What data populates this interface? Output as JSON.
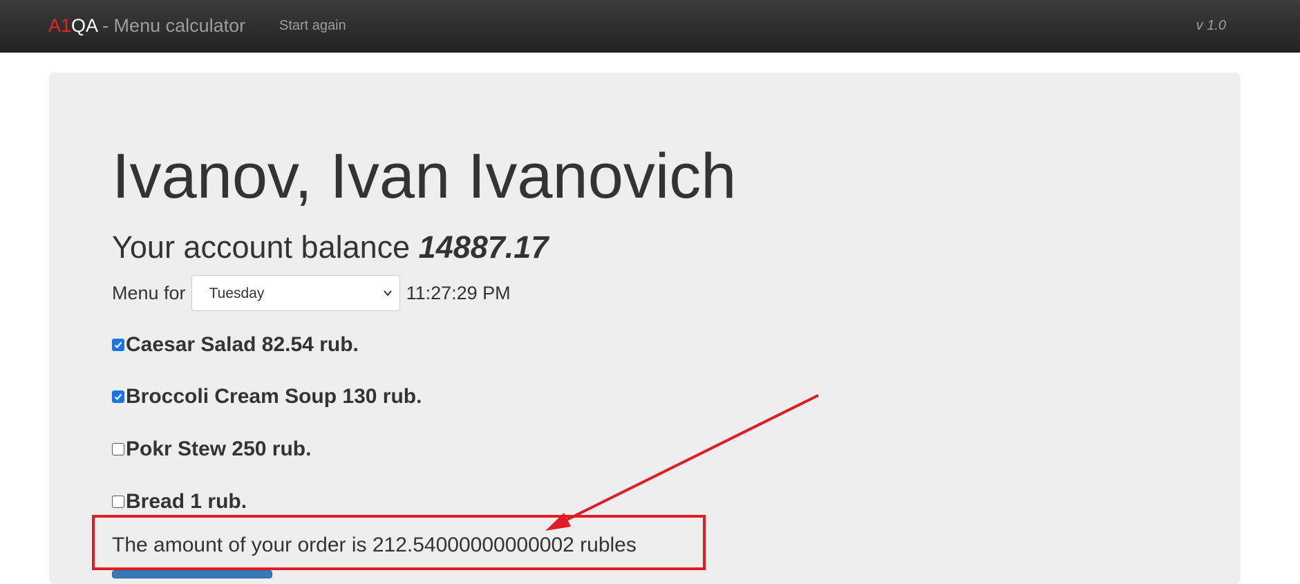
{
  "navbar": {
    "brand_a1": "A1",
    "brand_qa": "QA",
    "brand_rest": " - Menu calculator",
    "start_again": "Start again",
    "version": "v 1.0"
  },
  "user": {
    "name": "Ivanov, Ivan Ivanovich"
  },
  "account": {
    "balance_label": "Your account balance ",
    "balance_value": "14887.17"
  },
  "menu": {
    "label": "Menu for",
    "selected_day": "Tuesday",
    "time": "11:27:29 PM"
  },
  "dishes": [
    {
      "label": "Caesar Salad 82.54 rub.",
      "checked": true
    },
    {
      "label": "Broccoli Cream Soup 130 rub.",
      "checked": true
    },
    {
      "label": "Pokr Stew 250 rub.",
      "checked": false
    },
    {
      "label": "Bread 1 rub.",
      "checked": false
    }
  ],
  "order": {
    "total_text": "The amount of your order is 212.54000000000002 rubles"
  },
  "colors": {
    "brand_red": "#e3262b",
    "annotation_red": "#e31b23",
    "checkbox_blue": "#1a73e8",
    "jumbotron_bg": "#eeeeee",
    "navbar_bg": "#222222"
  },
  "icons": {
    "select_arrow": "chevron-down-icon",
    "checkbox_mark": "check-icon",
    "annotation": "arrow-annotation"
  }
}
